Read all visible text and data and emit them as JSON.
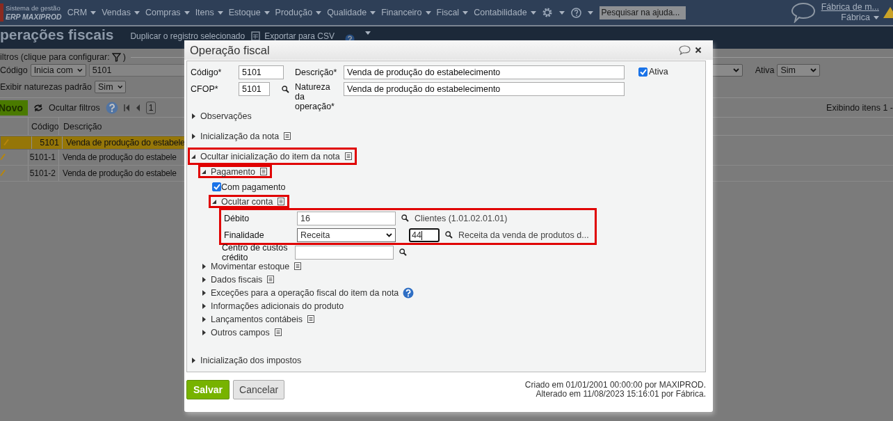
{
  "app": {
    "logo_line1": "Sistema de gestão",
    "logo_line2": "ERP MAXIPROD"
  },
  "nav": {
    "items": [
      "CRM",
      "Vendas",
      "Compras",
      "Itens",
      "Estoque",
      "Produção",
      "Qualidade",
      "Financeiro",
      "Fiscal",
      "Contabilidade"
    ],
    "search_placeholder": "Pesquisar na ajuda...",
    "user_link": "Fábrica de m...",
    "company": "Fábrica"
  },
  "page": {
    "title": "perações fiscais",
    "actions": [
      "Duplicar o registro selecionado",
      "Exportar para CSV"
    ]
  },
  "filters": {
    "legend": "iltros (clique para configurar:",
    "legend_end": ")",
    "code_label": "Código",
    "code_mode": "Inicia com",
    "code_value": "5101",
    "ativa_label": "Ativa",
    "ativa_value": "Sim",
    "natures_label": "Exibir naturezas padrão",
    "natures_value": "Sim"
  },
  "toolbar": {
    "new_button": "Novo",
    "hide_filters": "Ocultar filtros",
    "page": "1",
    "showing": "Exibindo itens 1 -"
  },
  "table": {
    "columns": [
      "Código",
      "Descrição"
    ],
    "rows": [
      {
        "code": "5101",
        "description": "Venda de produção do estabele",
        "selected": true
      },
      {
        "code": "5101-1",
        "description": "Venda de produção do estabele",
        "selected": false
      },
      {
        "code": "5101-2",
        "description": "Venda de produção do estabele",
        "selected": false
      }
    ]
  },
  "dialog": {
    "title": "Operação fiscal",
    "code_label": "Código*",
    "code": "5101",
    "cfop_label": "CFOP*",
    "cfop": "5101",
    "description_label": "Descrição*",
    "description": "Venda de produção do estabelecimento",
    "nature_label": "Natureza da operação*",
    "nature": "Venda de produção do estabelecimento",
    "active_label": "Ativa",
    "active": true,
    "sections": [
      {
        "kind": "section",
        "label": "Observações",
        "expanded": false,
        "note_icon": false,
        "help_icon": false,
        "highlighted": false
      },
      {
        "kind": "section",
        "label": "Inicialização da nota",
        "expanded": false,
        "note_icon": true,
        "help_icon": false,
        "highlighted": false
      },
      {
        "kind": "section",
        "label": "Ocultar inicialização do item da nota",
        "expanded": true,
        "note_icon": true,
        "help_icon": false,
        "highlighted": true,
        "children": [
          {
            "kind": "section",
            "label": "Pagamento",
            "expanded": true,
            "note_icon": true,
            "help_icon": false,
            "highlighted": true,
            "children": [
              {
                "kind": "checkbox",
                "label": "Com pagamento",
                "checked": true
              },
              {
                "kind": "section",
                "label": "Ocultar conta",
                "expanded": true,
                "note_icon": true,
                "help_icon": false,
                "highlighted": true,
                "children": [
                  {
                    "kind": "group",
                    "highlighted": true,
                    "children": [
                      {
                        "kind": "lookup",
                        "label": "Débito",
                        "value": "16",
                        "lookup_text": "Clientes (1.01.02.01.01)"
                      },
                      {
                        "kind": "select_lookup",
                        "label": "Finalidade",
                        "value": "Receita",
                        "code": "44",
                        "focused": true,
                        "lookup_text": "Receita da venda de produtos d..."
                      }
                    ]
                  },
                  {
                    "kind": "lookup",
                    "label": "Centro de custos crédito"
                  }
                ]
              }
            ]
          },
          {
            "kind": "section",
            "label": "Movimentar estoque",
            "expanded": false,
            "note_icon": true,
            "help_icon": false,
            "highlighted": false
          },
          {
            "kind": "section",
            "label": "Dados fiscais",
            "expanded": false,
            "note_icon": true,
            "help_icon": false,
            "highlighted": false
          },
          {
            "kind": "section",
            "label": "Exceções para a operação fiscal do item da nota",
            "expanded": false,
            "note_icon": false,
            "help_icon": true,
            "highlighted": false
          },
          {
            "kind": "section",
            "label": "Informações adicionais do produto",
            "expanded": false,
            "note_icon": false,
            "help_icon": false,
            "highlighted": false
          },
          {
            "kind": "section",
            "label": "Lançamentos contábeis",
            "expanded": false,
            "note_icon": true,
            "help_icon": false,
            "highlighted": false
          },
          {
            "kind": "section",
            "label": "Outros campos",
            "expanded": false,
            "note_icon": true,
            "help_icon": false,
            "highlighted": false
          }
        ]
      },
      {
        "kind": "section",
        "label": "Inicialização dos impostos",
        "expanded": false,
        "note_icon": false,
        "help_icon": false,
        "highlighted": false
      }
    ],
    "save": "Salvar",
    "cancel": "Cancelar",
    "created": "Criado em 01/01/2001 00:00:00 por MAXIPROD.",
    "modified": "Alterado em 11/08/2023 15:16:01 por Fábrica."
  }
}
